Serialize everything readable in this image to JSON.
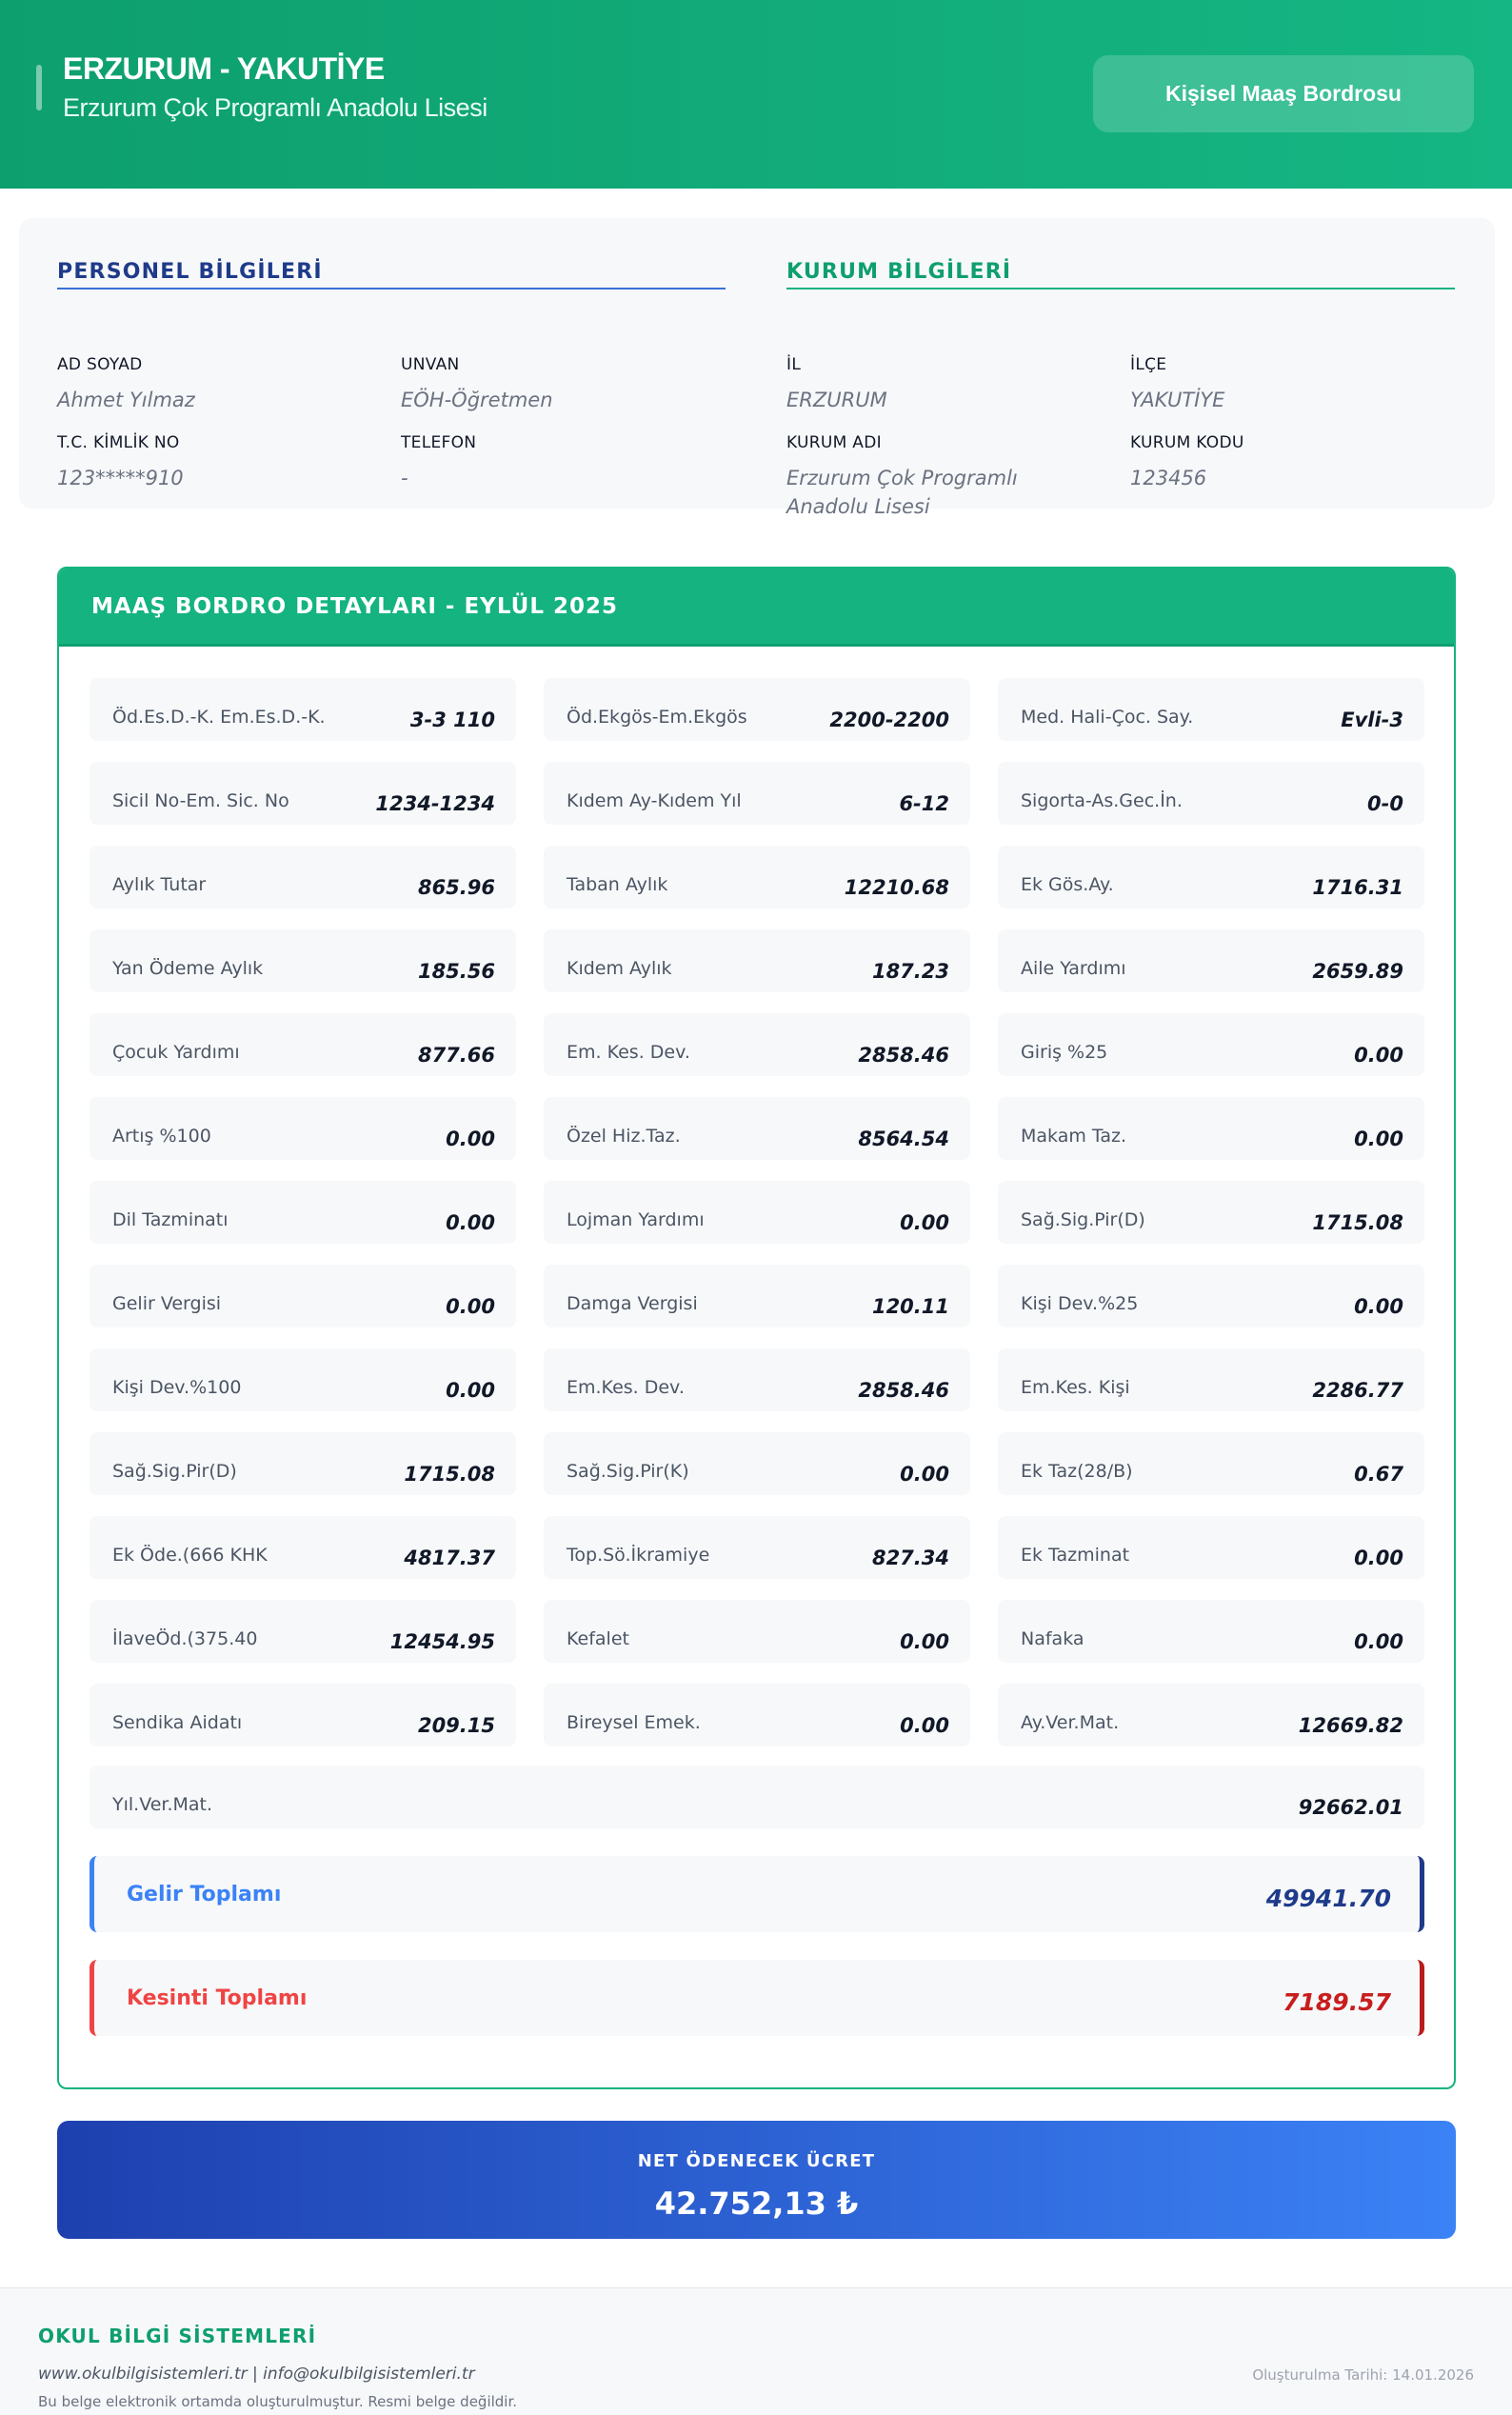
{
  "header": {
    "title": "ERZURUM - YAKUTİYE",
    "subtitle": "Erzurum Çok Programlı Anadolu Lisesi",
    "button_label": "Kişisel Maaş Bordrosu"
  },
  "personel": {
    "title": "PERSONEL BİLGİLERİ",
    "fields": [
      {
        "label": "AD SOYAD",
        "value": "Ahmet Yılmaz"
      },
      {
        "label": "UNVAN",
        "value": "EÖH-Öğretmen"
      },
      {
        "label": "T.C. KİMLİK NO",
        "value": "123*****910"
      },
      {
        "label": "TELEFON",
        "value": "-"
      }
    ]
  },
  "kurum": {
    "title": "KURUM BİLGİLERİ",
    "fields": [
      {
        "label": "İL",
        "value": "ERZURUM"
      },
      {
        "label": "İLÇE",
        "value": "YAKUTİYE"
      },
      {
        "label": "KURUM ADI",
        "value": "Erzurum Çok Programlı Anadolu Lisesi"
      },
      {
        "label": "KURUM KODU",
        "value": "123456"
      }
    ]
  },
  "details": {
    "title": "MAAŞ BORDRO DETAYLARI - EYLÜL 2025",
    "items": [
      {
        "label": "Öd.Es.D.-K. Em.Es.D.-K.",
        "value": "3-3 110"
      },
      {
        "label": "Öd.Ekgös-Em.Ekgös",
        "value": "2200-2200"
      },
      {
        "label": "Med. Hali-Çoc. Say.",
        "value": "Evli-3"
      },
      {
        "label": "Sicil No-Em. Sic. No",
        "value": "1234-1234"
      },
      {
        "label": "Kıdem Ay-Kıdem Yıl",
        "value": "6-12"
      },
      {
        "label": "Sigorta-As.Gec.İn.",
        "value": "0-0"
      },
      {
        "label": "Aylık Tutar",
        "value": "865.96"
      },
      {
        "label": "Taban Aylık",
        "value": "12210.68"
      },
      {
        "label": "Ek Gös.Ay.",
        "value": "1716.31"
      },
      {
        "label": "Yan Ödeme Aylık",
        "value": "185.56"
      },
      {
        "label": "Kıdem Aylık",
        "value": "187.23"
      },
      {
        "label": "Aile Yardımı",
        "value": "2659.89"
      },
      {
        "label": "Çocuk Yardımı",
        "value": "877.66"
      },
      {
        "label": "Em. Kes. Dev.",
        "value": "2858.46"
      },
      {
        "label": "Giriş %25",
        "value": "0.00"
      },
      {
        "label": "Artış %100",
        "value": "0.00"
      },
      {
        "label": "Özel Hiz.Taz.",
        "value": "8564.54"
      },
      {
        "label": "Makam Taz.",
        "value": "0.00"
      },
      {
        "label": "Dil Tazminatı",
        "value": "0.00"
      },
      {
        "label": "Lojman Yardımı",
        "value": "0.00"
      },
      {
        "label": "Sağ.Sig.Pir(D)",
        "value": "1715.08"
      },
      {
        "label": "Gelir Vergisi",
        "value": "0.00"
      },
      {
        "label": "Damga Vergisi",
        "value": "120.11"
      },
      {
        "label": "Kişi Dev.%25",
        "value": "0.00"
      },
      {
        "label": "Kişi Dev.%100",
        "value": "0.00"
      },
      {
        "label": "Em.Kes. Dev.",
        "value": "2858.46"
      },
      {
        "label": "Em.Kes. Kişi",
        "value": "2286.77"
      },
      {
        "label": "Sağ.Sig.Pir(D)",
        "value": "1715.08"
      },
      {
        "label": "Sağ.Sig.Pir(K)",
        "value": "0.00"
      },
      {
        "label": "Ek Taz(28/B)",
        "value": "0.67"
      },
      {
        "label": "Ek Öde.(666 KHK",
        "value": "4817.37"
      },
      {
        "label": "Top.Sö.İkramiye",
        "value": "827.34"
      },
      {
        "label": "Ek Tazminat",
        "value": "0.00"
      },
      {
        "label": "İlaveÖd.(375.40",
        "value": "12454.95"
      },
      {
        "label": "Kefalet",
        "value": "0.00"
      },
      {
        "label": "Nafaka",
        "value": "0.00"
      },
      {
        "label": "Sendika Aidatı",
        "value": "209.15"
      },
      {
        "label": "Bireysel Emek.",
        "value": "0.00"
      },
      {
        "label": "Ay.Ver.Mat.",
        "value": "12669.82"
      }
    ],
    "wide_item": {
      "label": "Yıl.Ver.Mat.",
      "value": "92662.01"
    },
    "gelir": {
      "label": "Gelir Toplamı",
      "value": "49941.70"
    },
    "kesinti": {
      "label": "Kesinti Toplamı",
      "value": "7189.57"
    }
  },
  "net": {
    "label": "NET ÖDENECEK ÜCRET",
    "value": "42.752,13 ₺"
  },
  "footer": {
    "brand": "OKUL BİLGİ SİSTEMLERİ",
    "links": "www.okulbilgisistemleri.tr | info@okulbilgisistemleri.tr",
    "note": "Bu belge elektronik ortamda oluşturulmuştur. Resmi belge değildir.",
    "date": "Oluşturulma Tarihi: 14.01.2026"
  },
  "colors": {
    "brand_green": "#14b37f",
    "brand_blue": "#1e3a8a",
    "accent_blue": "#3b82f6",
    "accent_red": "#ef4444"
  }
}
